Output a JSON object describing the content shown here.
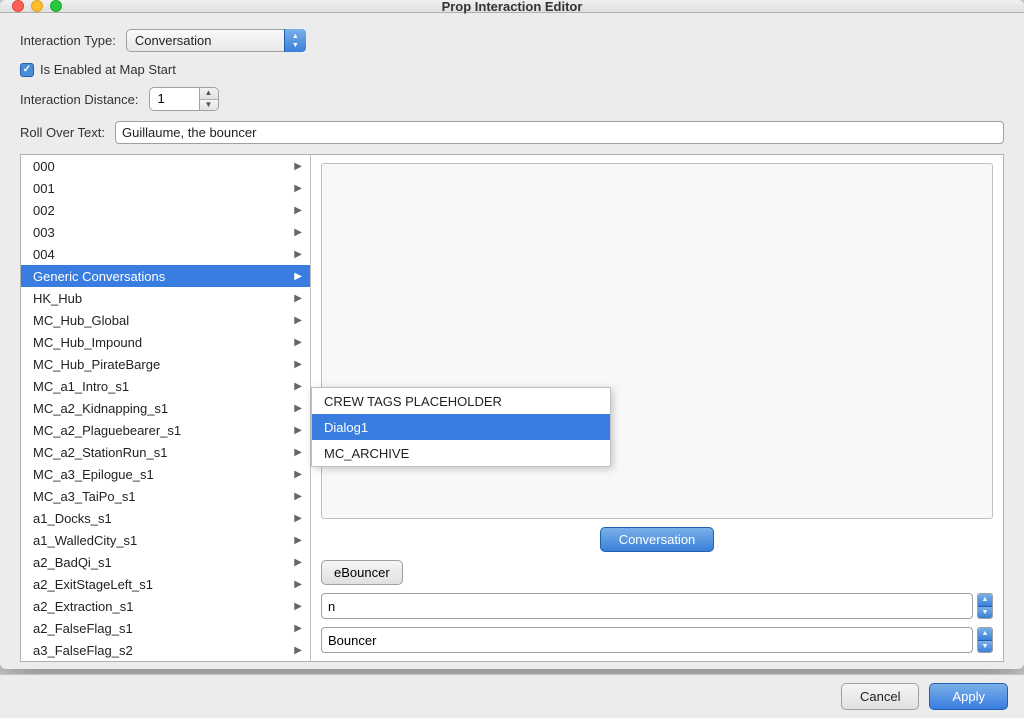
{
  "window": {
    "title": "Prop Interaction Editor"
  },
  "form": {
    "interaction_type_label": "Interaction Type:",
    "interaction_type_value": "Conversation",
    "is_enabled_label": "Is Enabled at Map Start",
    "is_enabled_checked": true,
    "interaction_distance_label": "Interaction Distance:",
    "interaction_distance_value": "1",
    "roll_over_text_label": "Roll Over Text:",
    "roll_over_text_value": "Guillaume, the bouncer"
  },
  "dropdown_list": {
    "items": [
      {
        "label": "000",
        "has_arrow": true
      },
      {
        "label": "001",
        "has_arrow": true
      },
      {
        "label": "002",
        "has_arrow": true
      },
      {
        "label": "003",
        "has_arrow": true
      },
      {
        "label": "004",
        "has_arrow": true
      },
      {
        "label": "Generic Conversations",
        "has_arrow": true,
        "selected": true
      },
      {
        "label": "HK_Hub",
        "has_arrow": true
      },
      {
        "label": "MC_Hub_Global",
        "has_arrow": true
      },
      {
        "label": "MC_Hub_Impound",
        "has_arrow": true
      },
      {
        "label": "MC_Hub_PirateBarge",
        "has_arrow": true
      },
      {
        "label": "MC_a1_Intro_s1",
        "has_arrow": true
      },
      {
        "label": "MC_a2_Kidnapping_s1",
        "has_arrow": true
      },
      {
        "label": "MC_a2_Plaguebearer_s1",
        "has_arrow": true
      },
      {
        "label": "MC_a2_StationRun_s1",
        "has_arrow": true
      },
      {
        "label": "MC_a3_Epilogue_s1",
        "has_arrow": true
      },
      {
        "label": "MC_a3_TaiPo_s1",
        "has_arrow": true
      },
      {
        "label": "a1_Docks_s1",
        "has_arrow": true
      },
      {
        "label": "a1_WalledCity_s1",
        "has_arrow": true
      },
      {
        "label": "a2_BadQi_s1",
        "has_arrow": true
      },
      {
        "label": "a2_ExitStageLeft_s1",
        "has_arrow": true
      },
      {
        "label": "a2_Extraction_s1",
        "has_arrow": true
      },
      {
        "label": "a2_FalseFlag_s1",
        "has_arrow": true
      },
      {
        "label": "a3_FalseFlag_s2",
        "has_arrow": true
      }
    ]
  },
  "submenu": {
    "items": [
      {
        "label": "CREW TAGS PLACEHOLDER",
        "selected": false
      },
      {
        "label": "Dialog1",
        "selected": true
      },
      {
        "label": "MC_ARCHIVE",
        "selected": false
      }
    ]
  },
  "right_panel": {
    "conversation_button": "Conversation",
    "bouncer_button": "eBouncer",
    "select1_value": "n",
    "select2_value": "Bouncer"
  },
  "footer": {
    "cancel_label": "Cancel",
    "apply_label": "Apply"
  }
}
